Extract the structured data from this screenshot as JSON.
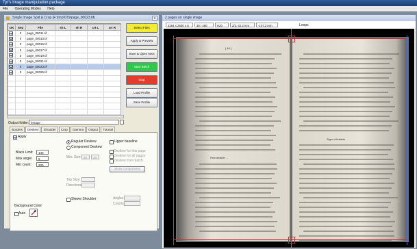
{
  "app": {
    "title": "Tyr's Image manipulation package",
    "menu": [
      "File",
      "Operating Modes",
      "Help"
    ]
  },
  "split_window": {
    "title": "Single Image Split & Crop (F:\\tmp\\0T9\\page_00023.tif)",
    "close_glyph": "x",
    "columns": [
      "OK",
      "Seq",
      "File",
      "sh L",
      "sh R",
      "crt L",
      "crt R"
    ],
    "rows": [
      {
        "ok": true,
        "seq": "0",
        "file": "page_00011.tif",
        "selected": false
      },
      {
        "ok": true,
        "seq": "0",
        "file": "page_00013.tif",
        "selected": false
      },
      {
        "ok": true,
        "seq": "0",
        "file": "page_00015.tif",
        "selected": false
      },
      {
        "ok": true,
        "seq": "0",
        "file": "page_00017.tif",
        "selected": false
      },
      {
        "ok": true,
        "seq": "0",
        "file": "page_00019.tif",
        "selected": false
      },
      {
        "ok": true,
        "seq": "0",
        "file": "page_00021.tif",
        "selected": false
      },
      {
        "ok": true,
        "seq": "0",
        "file": "page_00023.tif",
        "selected": true
      },
      {
        "ok": true,
        "seq": "0",
        "file": "page_00025.tif",
        "selected": false
      }
    ],
    "buttons": {
      "select_files": "Select Files",
      "apply_preview": "Apply & Preview",
      "save_open_next": "Save & Open Next",
      "start_batch": "Start Batch",
      "stop": "Stop",
      "load_profile": "Load Profile",
      "save_profile": "Save Profile"
    },
    "output_folder": {
      "label": "Output folder:",
      "value": "/Image"
    },
    "tabs": [
      "Borders",
      "Deskew",
      "Shoulder",
      "Crop",
      "Gamma",
      "Output",
      "Tutorial"
    ],
    "active_tab": "Deskew",
    "deskew": {
      "apply_label": "Apply",
      "regular_label": "Regular Deskew",
      "component_label": "Component Deskew",
      "upper_baseline_label": "Upper baseline",
      "black_limit_label": "Black Limit:",
      "black_limit_value": "140",
      "max_angle_label": "Max angle:",
      "max_angle_value": "5",
      "min_count_label": "Min count:",
      "min_count_value": "200",
      "min_size_label": "Min. Size:",
      "min_size_w": "20",
      "min_size_h": "20",
      "opt1": "Deskew for this page",
      "opt2": "Deskew for all pages",
      "opt3": "Deskew from batch",
      "show_components": "Show Components",
      "top_size_label": "Top Size:",
      "directions_label": "Directions:",
      "bg_color_label": "Background Color",
      "auto_label": "Auto",
      "skewe_shoulder_label": "Skewe Shoulder",
      "angles_label": "Angles:",
      "counts_label": "Counts:"
    }
  },
  "viewer": {
    "title": "2 pages on single image",
    "status": [
      "3264 x 2600 x 8",
      "30 / 490",
      "H20",
      "2/3, 42.2 mm",
      "-107.2 mm"
    ],
    "crop_label": "Loops",
    "left_page": {
      "page_no": "[ 48 ]",
      "section_heading": "Remarkable ...",
      "lines": 36
    },
    "right_page": {
      "section_heading": "Signs d'enfants",
      "lines": 38
    }
  },
  "colors": {
    "titlebar": "#1d3f72",
    "select_button": "#f2ec37",
    "start_button": "#2ec84a",
    "stop_button": "#e43c2c",
    "selected_row": "#b7ccec",
    "image_background": "#000000"
  }
}
